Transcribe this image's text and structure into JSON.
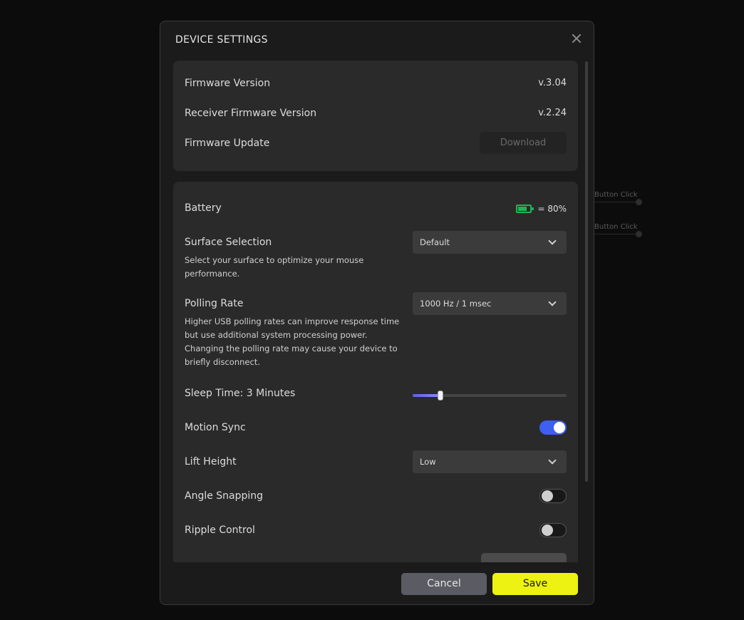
{
  "background": {
    "rows": [
      {
        "label": "Button Click"
      },
      {
        "label": "Button Click"
      }
    ]
  },
  "modal": {
    "title": "DEVICE SETTINGS",
    "close_icon": "close-icon"
  },
  "firmware": {
    "firmware_version_label": "Firmware Version",
    "firmware_version_value": "v.3.04",
    "receiver_label": "Receiver Firmware Version",
    "receiver_value": "v.2.24",
    "update_label": "Firmware Update",
    "download_label": "Download"
  },
  "settings": {
    "battery_label": "Battery",
    "battery_text": "= 80%",
    "battery_level": 0.8,
    "battery_color": "#1fb457",
    "surface_label": "Surface Selection",
    "surface_value": "Default",
    "surface_desc": "Select your surface to optimize your mouse performance.",
    "polling_label": "Polling Rate",
    "polling_value": "1000 Hz / 1 msec",
    "polling_desc": "Higher USB polling rates can improve response time but use additional system processing power. Changing the polling rate may cause your device to briefly disconnect.",
    "sleep_label": "Sleep Time: 3 Minutes",
    "sleep_level": 0.18,
    "motion_sync_label": "Motion Sync",
    "motion_sync_on": true,
    "lift_height_label": "Lift Height",
    "lift_height_value": "Low",
    "angle_snapping_label": "Angle Snapping",
    "angle_snapping_on": false,
    "ripple_control_label": "Ripple Control",
    "ripple_control_on": false
  },
  "footer": {
    "cancel_label": "Cancel",
    "save_label": "Save"
  },
  "colors": {
    "accent_toggle": "#3f5ef2",
    "save_button": "#eef212",
    "cancel_button": "#5b5c63"
  }
}
